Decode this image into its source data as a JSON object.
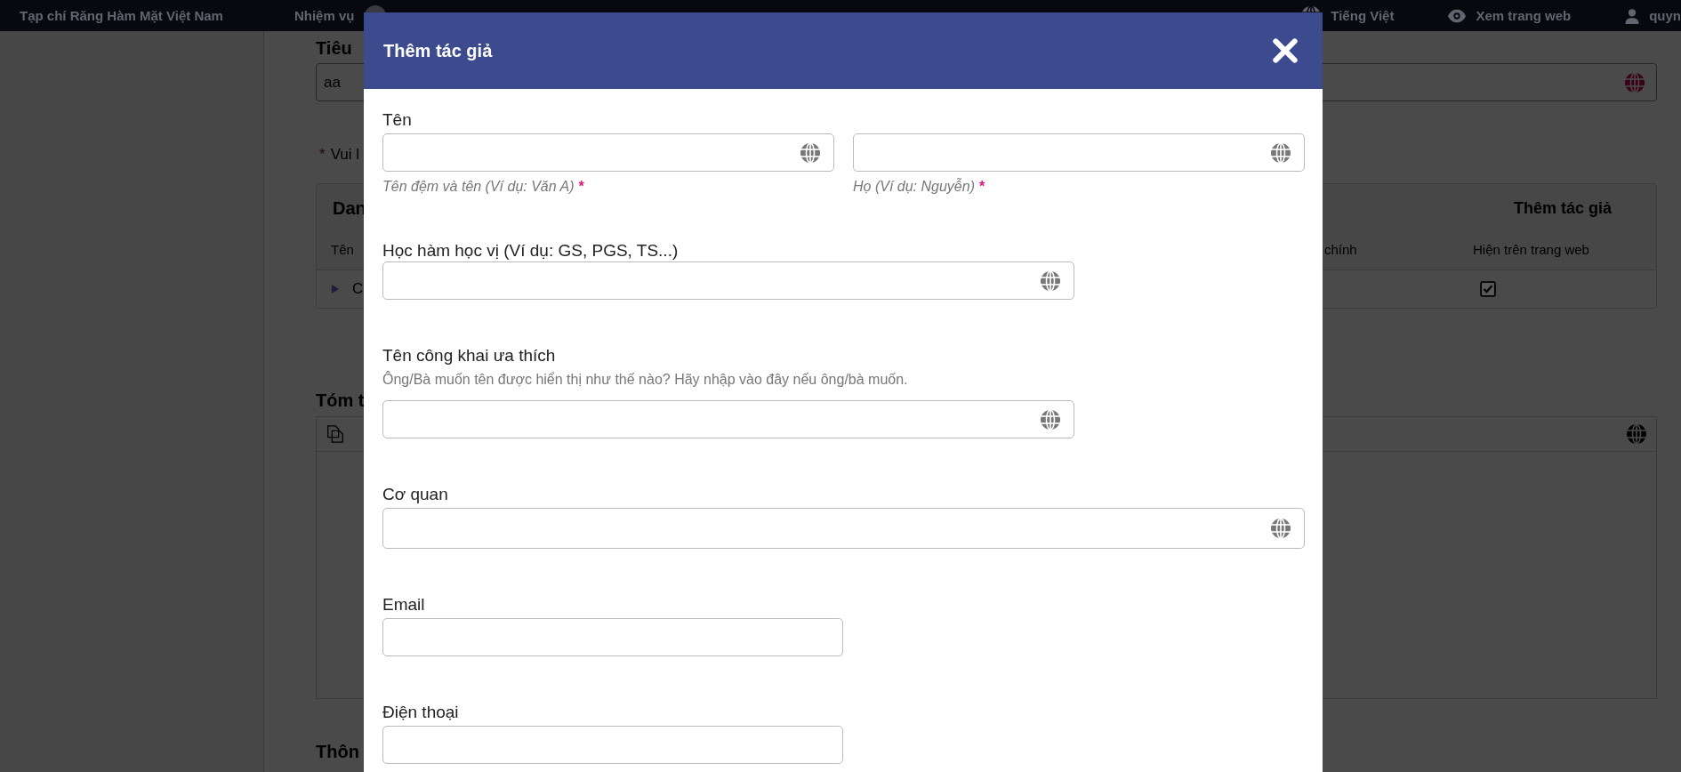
{
  "top_bar": {
    "site_title": "Tạp chí Răng Hàm Mặt Việt Nam",
    "tasks": "Nhiệm vụ",
    "language": "Tiếng Việt",
    "view_site": "Xem trang web",
    "user": "quyn"
  },
  "background_page": {
    "title_label": "Tiêu",
    "title_value": "aa",
    "required_mark": "*",
    "note": "Vui l",
    "authors_card": {
      "heading": "Dan",
      "add_button": "Thêm tác giả",
      "columns": [
        "Tên",
        "chính",
        "Hiện trên trang web"
      ],
      "rows": [
        {
          "name": "C",
          "visible_on_site": true
        }
      ]
    },
    "abstract_label": "Tóm t",
    "next_section": "Thôn"
  },
  "dialog": {
    "title": "Thêm tác giả",
    "fields": [
      {
        "label": "Tên",
        "kind": "split",
        "inputs": [
          {
            "help": "Tên đệm và tên (Ví dụ: Văn A)",
            "required": true,
            "multilingual": true
          },
          {
            "help": "Họ (Ví dụ: Nguyễn)",
            "required": true,
            "multilingual": true
          }
        ]
      },
      {
        "label": "Học hàm học vị (Ví dụ: GS, PGS, TS...)",
        "kind": "medium",
        "inputs": [
          {
            "required": false,
            "multilingual": true
          }
        ]
      },
      {
        "label": "Tên công khai ưa thích",
        "description": "Ông/Bà muốn tên được hiển thị như thế nào? Hãy nhập vào đây nếu ông/bà muốn.",
        "kind": "medium",
        "inputs": [
          {
            "required": false,
            "multilingual": true
          }
        ]
      },
      {
        "label": "Cơ quan",
        "kind": "wide",
        "inputs": [
          {
            "required": false,
            "multilingual": true
          }
        ]
      },
      {
        "label": "Email",
        "kind": "short",
        "inputs": [
          {
            "required": false,
            "multilingual": false
          }
        ]
      },
      {
        "label": "Điện thoại",
        "kind": "short",
        "inputs": [
          {
            "required": false,
            "multilingual": false
          }
        ]
      }
    ]
  }
}
